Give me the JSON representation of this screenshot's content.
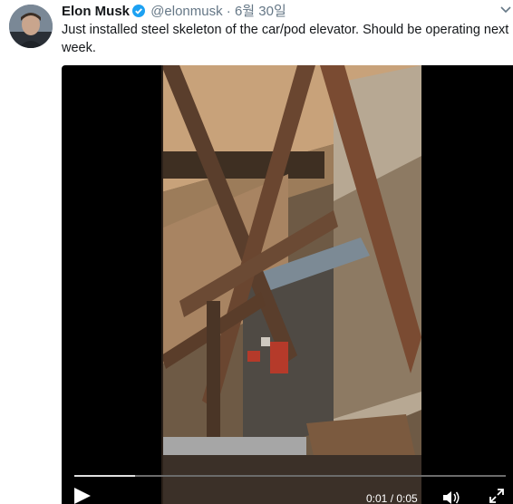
{
  "tweet": {
    "author_name": "Elon Musk",
    "handle": "@elonmusk",
    "separator": "·",
    "date": "6월 30일",
    "text": "Just installed steel skeleton of the car/pod elevator. Should be operating next week."
  },
  "video": {
    "time": "0:01 / 0:05",
    "progress": 0.14
  },
  "icons": {
    "verified": "verified-badge-icon",
    "play": "play-icon",
    "volume": "volume-icon",
    "fullscreen": "fullscreen-icon",
    "menu": "chevron-down-icon"
  },
  "colors": {
    "accent": "#1da1f2",
    "text": "#14171a",
    "muted": "#657786"
  }
}
